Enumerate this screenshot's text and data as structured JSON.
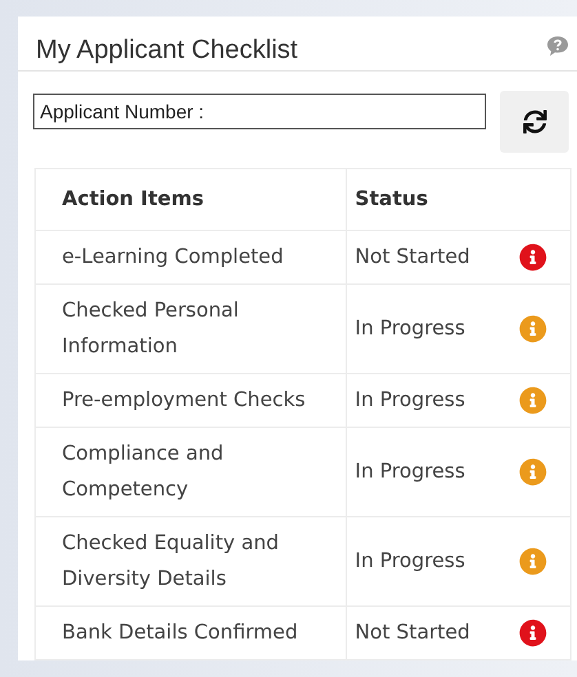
{
  "panel": {
    "title": "My Applicant Checklist"
  },
  "search": {
    "placeholder": "Applicant Number :"
  },
  "table": {
    "columns": [
      "Action Items",
      "Status"
    ],
    "rows": [
      {
        "item": "e-Learning Completed",
        "status": "Not Started",
        "color": "#e0121b"
      },
      {
        "item": "Checked Personal Information",
        "status": "In Progress",
        "color": "#eb9a1c"
      },
      {
        "item": "Pre-employment Checks",
        "status": "In Progress",
        "color": "#eb9a1c"
      },
      {
        "item": "Compliance and Competency",
        "status": "In Progress",
        "color": "#eb9a1c"
      },
      {
        "item": "Checked Equality and Diversity Details",
        "status": "In Progress",
        "color": "#eb9a1c"
      },
      {
        "item": "Bank Details Confirmed",
        "status": "Not Started",
        "color": "#e0121b"
      }
    ]
  }
}
